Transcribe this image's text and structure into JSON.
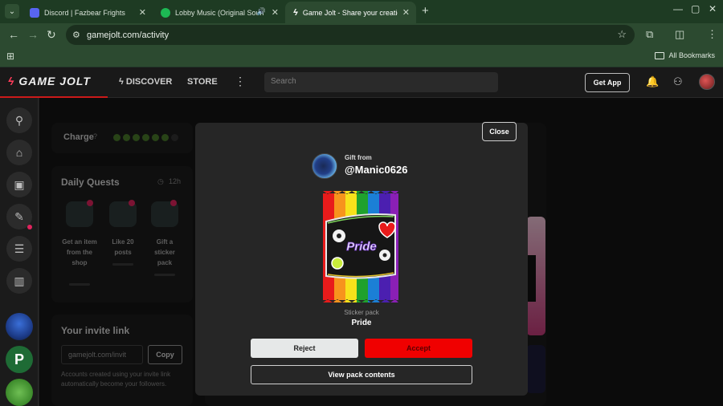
{
  "browser": {
    "tabs": [
      {
        "title": "Discord | Fazbear Frights",
        "icon": "discord-icon",
        "color": "#5865F2"
      },
      {
        "title": "Lobby Music (Original Soun",
        "icon": "spotify-icon",
        "color": "#1DB954"
      },
      {
        "title": "Game Jolt - Share your creation",
        "icon": "gamejolt-icon",
        "color": "#ffffff"
      }
    ],
    "url": "gamejolt.com/activity",
    "bookmarks_label": "All Bookmarks"
  },
  "gj": {
    "logo_text": "GAME JOLT",
    "nav": {
      "discover": "DISCOVER",
      "store": "STORE"
    },
    "search_placeholder": "Search",
    "get_app": "Get App",
    "accent": "#cc1a1a"
  },
  "background": {
    "charge_label": "Charge",
    "daily_quests_title": "Daily Quests",
    "quests_timer": "12h",
    "quests": [
      {
        "label": "Get an item from the shop"
      },
      {
        "label": "Like 20 posts"
      },
      {
        "label": "Gift a sticker pack"
      }
    ],
    "invite_title": "Your invite link",
    "invite_value": "gamejolt.com/invit",
    "copy_label": "Copy",
    "invite_note": "Accounts created using your invite link automatically become your followers."
  },
  "modal": {
    "close_label": "Close",
    "gift_from_label": "Gift from",
    "gifter": "@Manic0626",
    "pack_type": "Sticker pack",
    "pack_name": "Pride",
    "pack_logo_text": "Pride",
    "reject_label": "Reject",
    "accept_label": "Accept",
    "view_label": "View pack contents",
    "accept_color": "#f00000"
  }
}
